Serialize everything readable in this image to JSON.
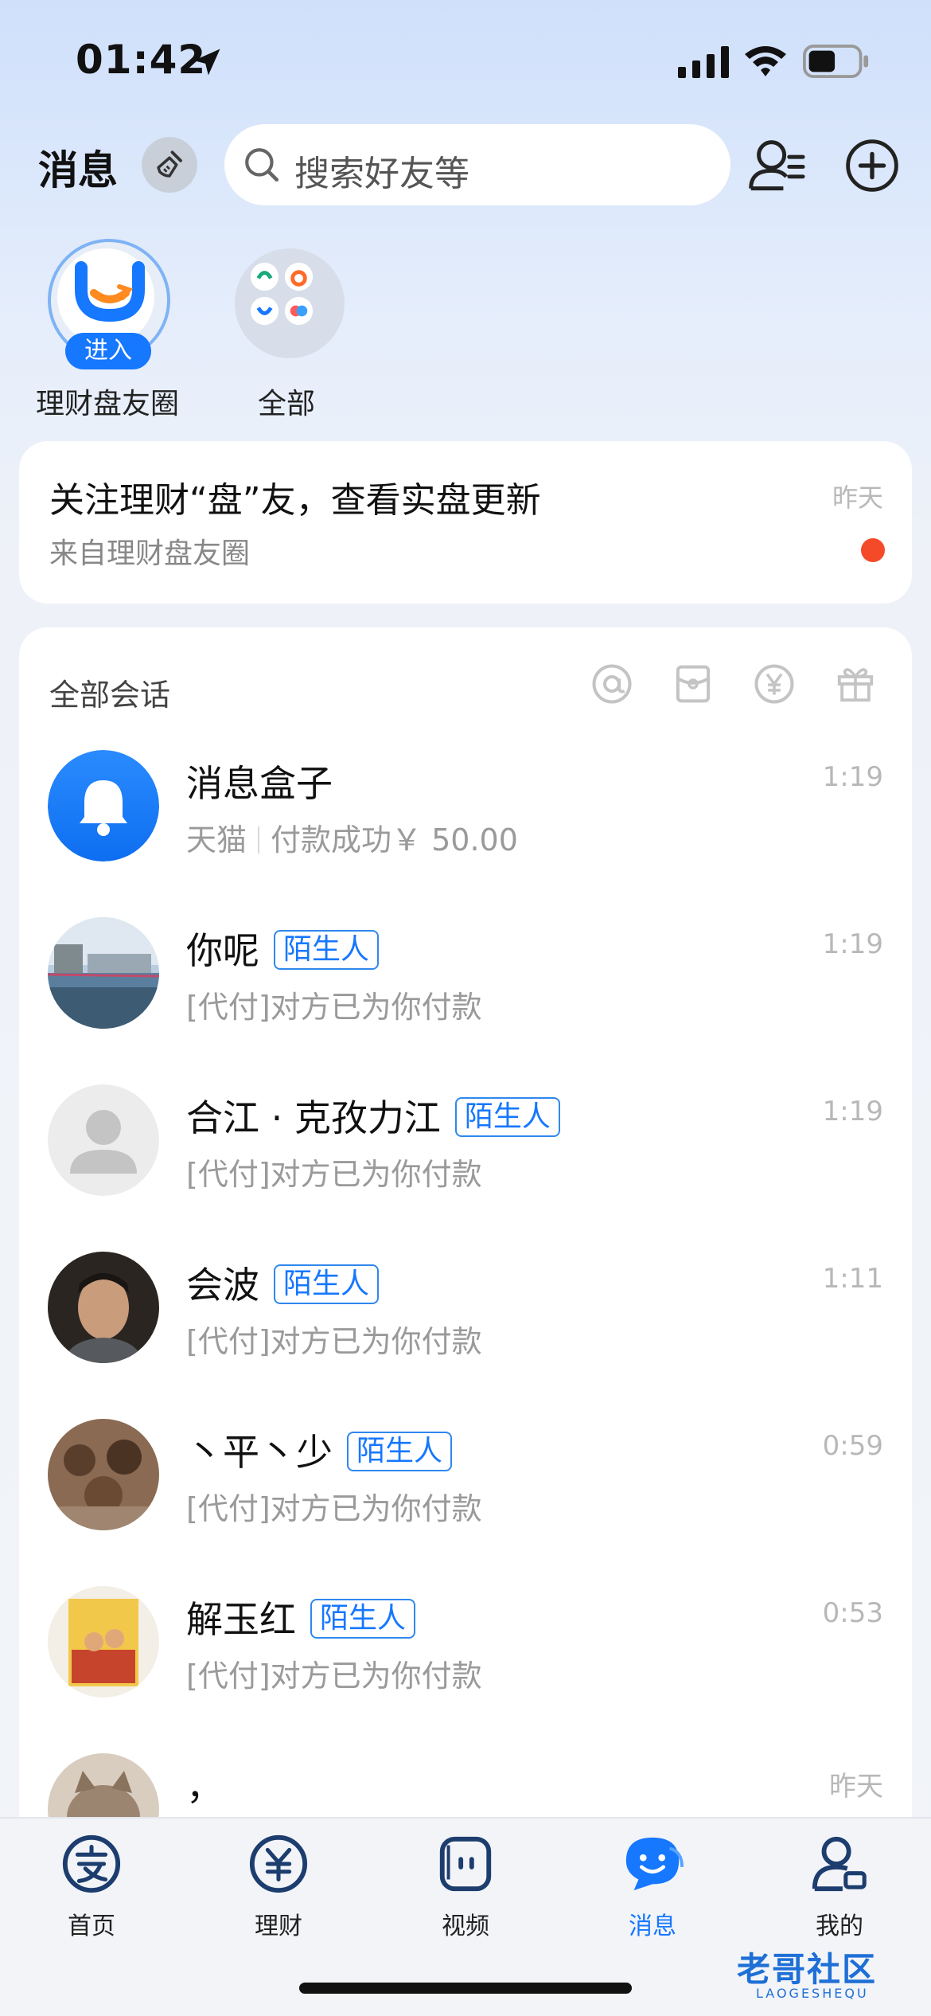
{
  "status_bar": {
    "time": "01:42"
  },
  "header": {
    "title": "消息",
    "search_placeholder": "搜索好友等"
  },
  "shortcuts": [
    {
      "label": "理财盘友圈",
      "badge": "进入"
    },
    {
      "label": "全部"
    }
  ],
  "notice": {
    "title": "关注理财“盘”友，查看实盘更新",
    "subtitle": "来自理财盘友圈",
    "time": "昨天"
  },
  "chats": {
    "header_label": "全部会话",
    "items": [
      {
        "name": "消息盒子",
        "preview_source": "天猫",
        "preview": "付款成功￥ 50.00",
        "time": "1:19"
      },
      {
        "name": "你呢",
        "badge": "陌生人",
        "preview": "[代付]对方已为你付款",
        "time": "1:19"
      },
      {
        "name": "合江 · 克孜力江",
        "badge": "陌生人",
        "preview": "[代付]对方已为你付款",
        "time": "1:19"
      },
      {
        "name": "会波",
        "badge": "陌生人",
        "preview": "[代付]对方已为你付款",
        "time": "1:11"
      },
      {
        "name": "丶平丶少",
        "badge": "陌生人",
        "preview": "[代付]对方已为你付款",
        "time": "0:59"
      },
      {
        "name": "解玉红",
        "badge": "陌生人",
        "preview": "[代付]对方已为你付款",
        "time": "0:53"
      },
      {
        "name": "，",
        "preview": "",
        "time": "昨天"
      }
    ]
  },
  "tabs": [
    {
      "label": "首页",
      "icon": "alipay-home-icon"
    },
    {
      "label": "理财",
      "icon": "yuan-circle-icon"
    },
    {
      "label": "视频",
      "icon": "video-icon"
    },
    {
      "label": "消息",
      "icon": "chat-bubble-icon",
      "active": true
    },
    {
      "label": "我的",
      "icon": "profile-icon"
    }
  ],
  "watermark": {
    "text": "老哥社区",
    "sub": "LAOGESHEQU"
  },
  "colors": {
    "accent": "#1677ff",
    "notice_dot": "#f44a2a"
  }
}
